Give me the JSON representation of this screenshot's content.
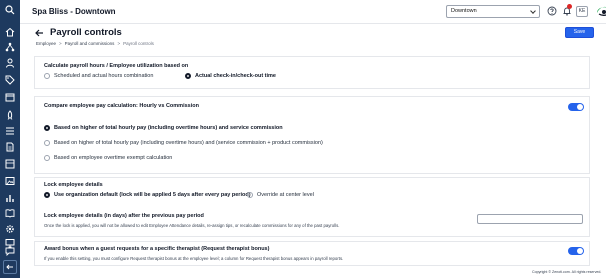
{
  "app": {
    "brand": "Spa Bliss - Downtown"
  },
  "topbar": {
    "location": {
      "selected": "Downtown"
    },
    "user_initials": "KE",
    "icons": [
      "help-icon",
      "bell-icon",
      "gift-icon",
      "logo"
    ]
  },
  "sidebar": {
    "icons": [
      "search-icon",
      "home-icon",
      "network-icon",
      "person-icon",
      "tag-icon",
      "calendar-icon",
      "rocket-icon",
      "list-icon",
      "document-icon",
      "inventory-icon",
      "image-icon",
      "reports-icon",
      "book-icon",
      "gear-icon",
      "screen-icon",
      "chat-icon",
      "collapse-icon"
    ]
  },
  "header": {
    "title": "Payroll controls",
    "breadcrumb": [
      "Employee",
      "Payroll and commissions",
      "Payroll controls"
    ],
    "save_label": "Save"
  },
  "sections": {
    "utilization": {
      "title": "Calculate payroll hours / Employee utilization based on",
      "options": [
        "Scheduled and actual hours combination",
        "Actual check-in/check-out time"
      ],
      "selected_index": 1
    },
    "pay_calc": {
      "title": "Compare employee pay calculation: Hourly vs Commission",
      "enabled": true,
      "options": [
        "Based on higher of total hourly pay (including overtime hours) and service commission",
        "Based on higher of total hourly pay (including overtime hours) and (service commission + product commission)",
        "Based on employee overtime exempt calculation"
      ],
      "selected_index": 0
    },
    "lock": {
      "title": "Lock employee details",
      "options": [
        "Use organization default (lock will be applied 5 days after every pay period)",
        "Override at center level"
      ],
      "selected_index": 0,
      "days_title": "Lock employee details (in days) after the previous pay period",
      "days_help": "Once the lock is applied, you will not be allowed to edit Employee Attendance details, re-assign tips, or recalculate commissions for any of the past payrolls.",
      "days_value": ""
    },
    "bonus": {
      "title": "Award bonus when a guest requests for a specific therapist (Request therapist bonus)",
      "help": "If you enable this setting, you must configure Request therapist bonus at the employee level; a column for Request therapist bonus appears in payroll reports.",
      "enabled": true
    }
  },
  "footer": {
    "copyright": "Copyright © Zenoti.com. All rights reserved."
  },
  "colors": {
    "sidebar": "#1e3a5f",
    "accent": "#2563eb",
    "alert": "#dc2626"
  }
}
